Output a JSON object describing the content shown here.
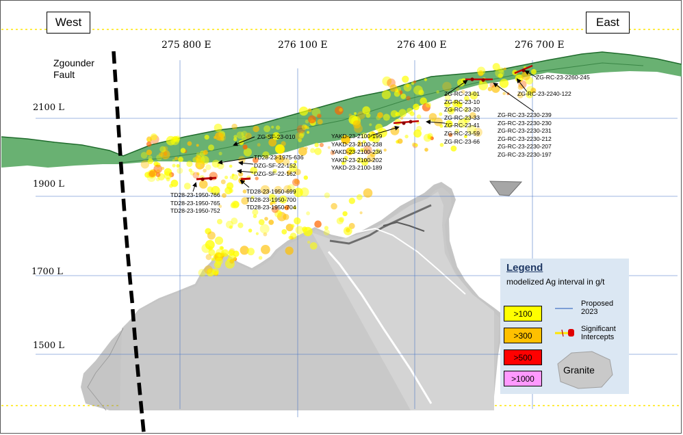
{
  "directions": {
    "west": "West",
    "east": "East"
  },
  "fault_label": [
    "Zgounder",
    "Fault"
  ],
  "eastings": [
    "275 800 E",
    "276 100 E",
    "276 400 E",
    "276 700 E"
  ],
  "levels": [
    "2100 L",
    "1900 L",
    "1700 L",
    "1500 L"
  ],
  "hole_groups": {
    "sf010": [
      "ZG-SF-23-010"
    ],
    "td1975": [
      "TD28-23-1975-636"
    ],
    "dzg": [
      "DZG-SF-22-152",
      "DZG-SF-22-162"
    ],
    "td1950a": [
      "TD28-23-1950-766",
      "TD28-23-1950-765",
      "TD28-23-1950-752"
    ],
    "td1950b": [
      "TD28-23-1950-699",
      "TD28-23-1950-700",
      "TD28-23-1950-704"
    ],
    "yakd": [
      "YAKD-23-2100-199",
      "YAKD-23-2100-238",
      "YAKD-23-2100-236",
      "YAKD-23-2100-202",
      "YAKD-23-2100-189"
    ],
    "zgrc": [
      "ZG-RC-23-01",
      "ZG-RC-23-10",
      "ZG-RC-23-20",
      "ZG-RC-23-33",
      "ZG-RC-23-41",
      "ZG-RC-23-59",
      "ZG-RC-23-66"
    ],
    "rc2230": [
      "ZG-RC-23-2230-239",
      "ZG-RC-23-2230-230",
      "ZG-RC-23-2230-231",
      "ZG-RC-23-2230-212",
      "ZG-RC-23-2230-207",
      "ZG-RC-23-2230-197"
    ],
    "rc2260": [
      "ZG-RC-23-2260-245"
    ],
    "rc2240": [
      "ZG-RC-23-2240-122"
    ]
  },
  "legend": {
    "title": "Legend",
    "subtitle": "modelized Ag interval in g/t",
    "grades": [
      {
        "label": ">100",
        "color": "#ffff00"
      },
      {
        "label": ">300",
        "color": "#ffc000"
      },
      {
        "label": ">500",
        "color": "#ff0000"
      },
      {
        "label": ">1000",
        "color": "#ff99ff"
      }
    ],
    "proposed": "Proposed 2023",
    "intercepts": "Significant Intercepts",
    "granite": "Granite"
  },
  "colors": {
    "grid": "#4472c4",
    "topo_fill": "#3f9b4a",
    "topo_dark": "#1f6b2c",
    "granite": "#c8c8c8",
    "granite_dark": "#7f7f7f",
    "mineral_low": "#ffff00",
    "mineral_mid": "#ffc000",
    "mineral_high": "#ff6600",
    "legend_bg": "#dbe7f3",
    "fault": "#000000",
    "dotted": "#ffe600"
  }
}
